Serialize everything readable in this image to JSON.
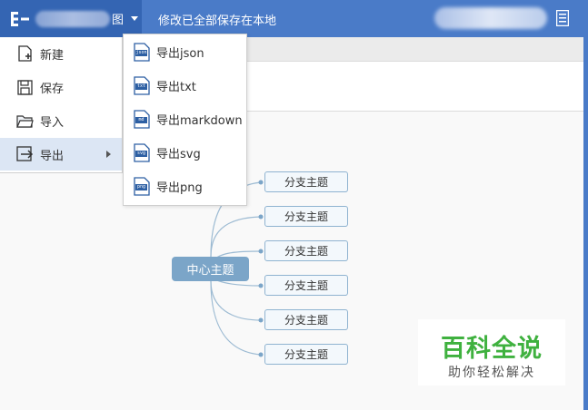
{
  "app": {
    "title_tail": "图",
    "save_status": "修改已全部保存在本地"
  },
  "file_menu": {
    "items": [
      {
        "label": "新建",
        "icon": "new-file-icon"
      },
      {
        "label": "保存",
        "icon": "save-icon"
      },
      {
        "label": "导入",
        "icon": "folder-open-icon"
      },
      {
        "label": "导出",
        "icon": "export-icon",
        "has_submenu": true,
        "active": true
      }
    ]
  },
  "export_menu": {
    "items": [
      {
        "label": "导出json",
        "tag": "json"
      },
      {
        "label": "导出txt",
        "tag": "txt"
      },
      {
        "label": "导出markdown",
        "tag": "md"
      },
      {
        "label": "导出svg",
        "tag": "svg"
      },
      {
        "label": "导出png",
        "tag": "png"
      }
    ]
  },
  "mindmap": {
    "central_topic": "中心主题",
    "branches": [
      "分支主题",
      "分支主题",
      "分支主题",
      "分支主题",
      "分支主题",
      "分支主题"
    ]
  },
  "watermark": {
    "title": "百科全说",
    "subtitle": "助你轻松解决"
  },
  "colors": {
    "header_blue": "#4a7bc8",
    "app_button_blue": "#3465b3",
    "menu_active": "#dce6f4",
    "central_topic": "#7ba5c8",
    "branch_border": "#8fb3d0",
    "watermark_green": "#3fb13f"
  }
}
